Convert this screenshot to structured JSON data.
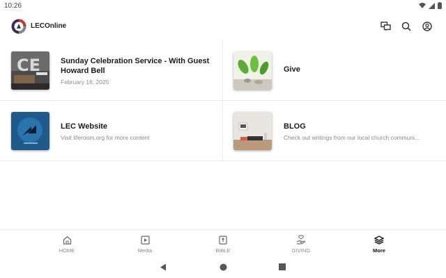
{
  "status": {
    "time": "10:26"
  },
  "app": {
    "title": "LECOnline"
  },
  "cards": [
    {
      "title": "Sunday Celebration Service - With Guest Howard Bell",
      "subtitle": "February 16, 2025",
      "thumb": "sermon-thumbnail"
    },
    {
      "title": "Give",
      "subtitle": "",
      "thumb": "plants-thumbnail"
    },
    {
      "title": "LEC Website",
      "subtitle": "Visit liferoom.org for more content",
      "thumb": "website-thumbnail"
    },
    {
      "title": "BLOG",
      "subtitle": "Check out writings from our local church communi...",
      "thumb": "desk-thumbnail"
    }
  ],
  "nav": [
    {
      "label": "HOME",
      "icon": "home-icon"
    },
    {
      "label": "Media",
      "icon": "play-icon"
    },
    {
      "label": "BIBLE",
      "icon": "bible-icon"
    },
    {
      "label": "GIVING",
      "icon": "giving-icon"
    },
    {
      "label": "More",
      "icon": "layers-icon",
      "active": true
    }
  ],
  "colors": {
    "accent": "#1a1a1a",
    "muted": "#8a8a8a",
    "divider": "#ececec"
  }
}
